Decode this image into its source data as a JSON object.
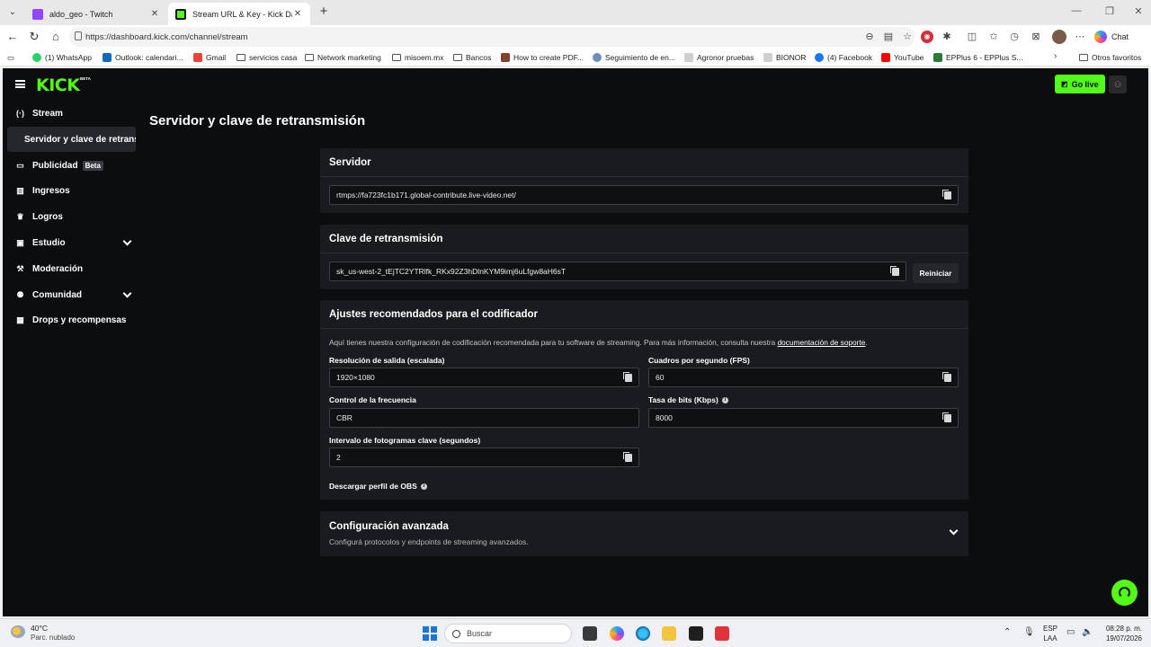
{
  "browser": {
    "tabs": [
      {
        "title": "aldo_geo - Twitch",
        "active": false
      },
      {
        "title": "Stream URL & Key - Kick Dashboard",
        "active": true
      }
    ],
    "url": "https://dashboard.kick.com/channel/stream",
    "chat_label": "Chat",
    "bookmarks": [
      {
        "label": "(1) WhatsApp"
      },
      {
        "label": "Outlook: calendari..."
      },
      {
        "label": "Gmail"
      },
      {
        "label": "servicios casa"
      },
      {
        "label": "Network marketing"
      },
      {
        "label": "misoem.mx"
      },
      {
        "label": "Bancos"
      },
      {
        "label": "How to create PDF..."
      },
      {
        "label": "Seguimiento de en..."
      },
      {
        "label": "Agronor pruebas"
      },
      {
        "label": "BIONOR"
      },
      {
        "label": "(4) Facebook"
      },
      {
        "label": "YouTube"
      },
      {
        "label": "EPPlus 6 - EPPlus S..."
      },
      {
        "label": "Otros favoritos"
      }
    ]
  },
  "kick": {
    "logo": "KICK",
    "logo_badge": "BETA",
    "go_live": "Go live",
    "sidebar": {
      "stream": "Stream",
      "stream_sub": "Servidor y clave de retransmisión",
      "publicidad": "Publicidad",
      "publicidad_badge": "Beta",
      "ingresos": "Ingresos",
      "logros": "Logros",
      "estudio": "Estudio",
      "moderacion": "Moderación",
      "comunidad": "Comunidad",
      "drops": "Drops y recompensas"
    },
    "page_title": "Servidor y clave de retransmisión",
    "server": {
      "heading": "Servidor",
      "value": "rtmps://fa723fc1b171.global-contribute.live-video.net/"
    },
    "stream_key": {
      "heading": "Clave de retransmisión",
      "value": "sk_us-west-2_tEjTC2YTRlfk_RKx92Z3hDlnKYM9imj6uLfgw8aH6sT",
      "reset_label": "Reiniciar"
    },
    "encoder": {
      "heading": "Ajustes recomendados para el codificador",
      "help_text": "Aquí tienes nuestra configuración de codificación recomendada para tu software de streaming. Para más información, consulta nuestra ",
      "help_link": "documentación de soporte",
      "help_end": ".",
      "resolution_label": "Resolución de salida (escalada)",
      "resolution_value": "1920×1080",
      "fps_label": "Cuadros por segundo (FPS)",
      "fps_value": "60",
      "rate_control_label": "Control de la frecuencia",
      "rate_control_value": "CBR",
      "bitrate_label": "Tasa de bits (Kbps)",
      "bitrate_value": "8000",
      "keyframe_label": "Intervalo de fotogramas clave (segundos)",
      "keyframe_value": "2",
      "obs_profile_label": "Descargar perfil de OBS"
    },
    "advanced": {
      "heading": "Configuración avanzada",
      "subtitle": "Configurá protocolos y endpoints de streaming avanzados."
    }
  },
  "taskbar": {
    "temperature": "40°C",
    "condition": "Parc. nublado",
    "search_placeholder": "Buscar",
    "language_top": "ESP",
    "language_bottom": "LAA",
    "time": "08:28 p. m.",
    "date": "19/07/2026"
  },
  "colors": {
    "kick_green": "#53fc18",
    "app_bg": "#0b0d0e",
    "card_bg": "#191b1f"
  }
}
